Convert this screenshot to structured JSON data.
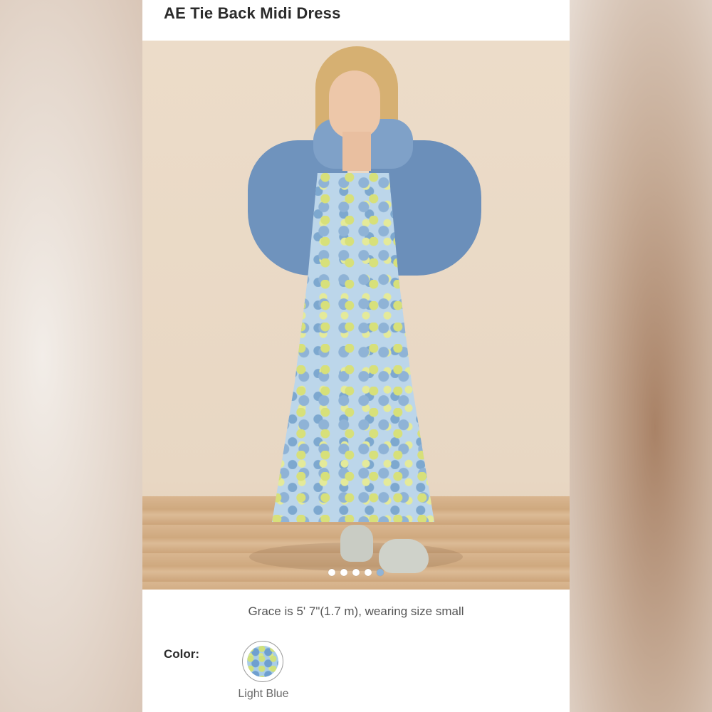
{
  "product": {
    "title": "AE Tie Back Midi Dress"
  },
  "gallery": {
    "image_count": 5,
    "active_index": 4,
    "caption": "Grace is 5' 7\"(1.7 m), wearing size small"
  },
  "color": {
    "label": "Color:",
    "selected": "Light Blue",
    "swatch_color": "#a9cde6"
  },
  "icons": {
    "swatch": "floral-swatch-icon"
  }
}
